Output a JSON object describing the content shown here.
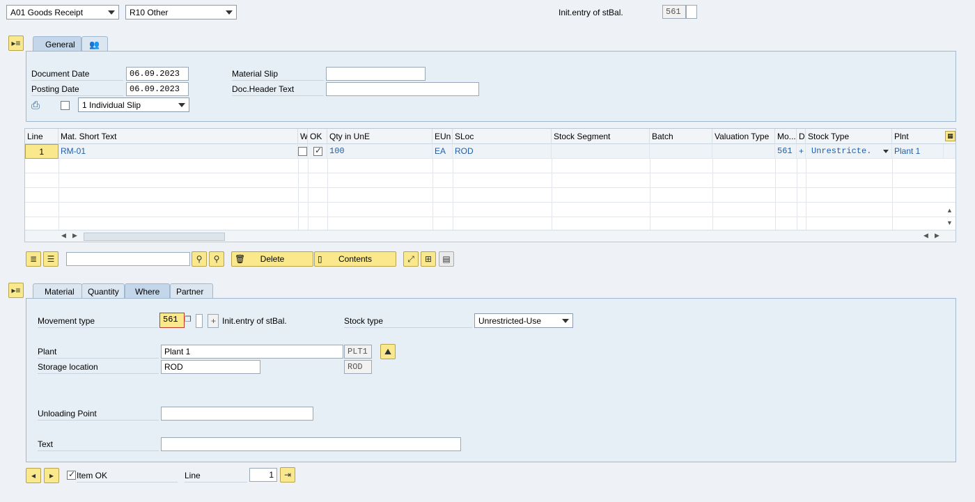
{
  "header": {
    "action_select": "A01 Goods Receipt",
    "ref_select": "R10 Other",
    "init_entry_label": "Init.entry of stBal.",
    "init_entry_value": "561"
  },
  "general_tabs": [
    "General"
  ],
  "general": {
    "document_date_label": "Document Date",
    "document_date": "06.09.2023",
    "posting_date_label": "Posting Date",
    "posting_date": "06.09.2023",
    "material_slip_label": "Material Slip",
    "material_slip": "",
    "doc_header_text_label": "Doc.Header Text",
    "doc_header_text": "",
    "slip_select": "1 Individual Slip"
  },
  "table": {
    "columns": [
      "Line",
      "Mat. Short Text",
      "W",
      "OK",
      "Qty in UnE",
      "EUn",
      "SLoc",
      "Stock Segment",
      "Batch",
      "Valuation Type",
      "Mo...",
      "D",
      "Stock Type",
      "Plnt"
    ],
    "row": {
      "line": "1",
      "mat_short_text": "RM-01",
      "qty": "100",
      "eun": "EA",
      "sloc": "ROD",
      "mo": "561",
      "d": "+",
      "stock_type": "Unrestricte.",
      "plnt": "Plant 1"
    }
  },
  "toolbar": {
    "delete_label": "Delete",
    "contents_label": "Contents",
    "search_value": ""
  },
  "detail_tabs": [
    "Material",
    "Quantity",
    "Where",
    "Partner"
  ],
  "detail": {
    "movement_type_label": "Movement type",
    "movement_type": "561",
    "movement_sign": "+",
    "movement_text": "Init.entry of stBal.",
    "stock_type_label": "Stock type",
    "stock_type": "Unrestricted-Use",
    "plant_label": "Plant",
    "plant": "Plant 1",
    "plant_code": "PLT1",
    "storage_location_label": "Storage location",
    "storage_location": "ROD",
    "storage_location_code": "ROD",
    "unloading_point_label": "Unloading Point",
    "unloading_point": "",
    "text_label": "Text",
    "text": ""
  },
  "footer": {
    "item_ok_label": "Item OK",
    "line_label": "Line",
    "line_value": "1"
  }
}
